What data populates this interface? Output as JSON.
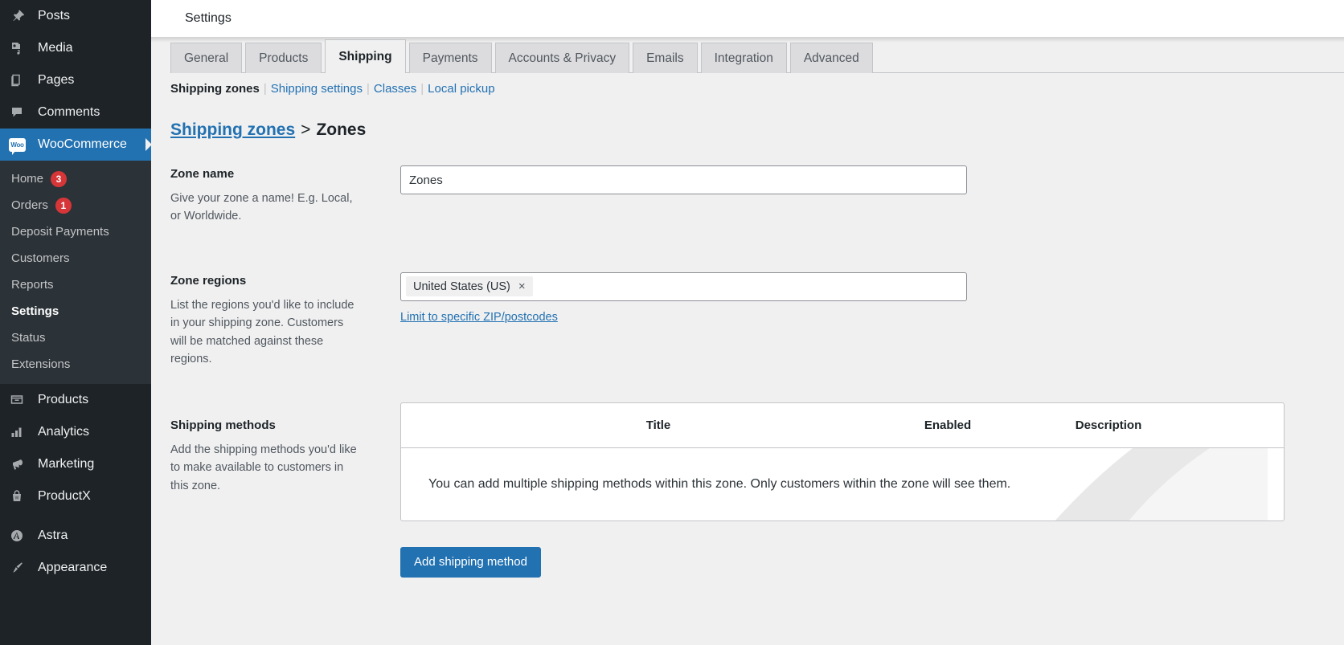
{
  "sidebar": {
    "items": [
      {
        "label": "Posts",
        "icon": "pin-icon",
        "current": false
      },
      {
        "label": "Media",
        "icon": "media-icon",
        "current": false
      },
      {
        "label": "Pages",
        "icon": "pages-icon",
        "current": false
      },
      {
        "label": "Comments",
        "icon": "comment-icon",
        "current": false
      },
      {
        "label": "WooCommerce",
        "icon": "woocommerce-icon",
        "current": true
      }
    ],
    "submenu": [
      {
        "label": "Home",
        "badge": "3",
        "current": false
      },
      {
        "label": "Orders",
        "badge": "1",
        "current": false
      },
      {
        "label": "Deposit Payments",
        "badge": "",
        "current": false
      },
      {
        "label": "Customers",
        "badge": "",
        "current": false
      },
      {
        "label": "Reports",
        "badge": "",
        "current": false
      },
      {
        "label": "Settings",
        "badge": "",
        "current": true
      },
      {
        "label": "Status",
        "badge": "",
        "current": false
      },
      {
        "label": "Extensions",
        "badge": "",
        "current": false
      }
    ],
    "items_lower": [
      {
        "label": "Products",
        "icon": "products-icon"
      },
      {
        "label": "Analytics",
        "icon": "analytics-icon"
      },
      {
        "label": "Marketing",
        "icon": "megaphone-icon"
      },
      {
        "label": "ProductX",
        "icon": "productx-icon"
      }
    ],
    "items_bottom": [
      {
        "label": "Astra",
        "icon": "astra-icon"
      },
      {
        "label": "Appearance",
        "icon": "brush-icon"
      }
    ],
    "woo_badge_text": "Woo"
  },
  "topbar": {
    "title": "Settings"
  },
  "tabs": [
    {
      "label": "General",
      "active": false
    },
    {
      "label": "Products",
      "active": false
    },
    {
      "label": "Shipping",
      "active": true
    },
    {
      "label": "Payments",
      "active": false
    },
    {
      "label": "Accounts & Privacy",
      "active": false
    },
    {
      "label": "Emails",
      "active": false
    },
    {
      "label": "Integration",
      "active": false
    },
    {
      "label": "Advanced",
      "active": false
    }
  ],
  "subnav": [
    {
      "label": "Shipping zones",
      "current": true
    },
    {
      "label": "Shipping settings",
      "current": false
    },
    {
      "label": "Classes",
      "current": false
    },
    {
      "label": "Local pickup",
      "current": false
    }
  ],
  "breadcrumb": {
    "parent": "Shipping zones",
    "separator": ">",
    "current": "Zones"
  },
  "zone_name": {
    "title": "Zone name",
    "description": "Give your zone a name! E.g. Local, or Worldwide.",
    "value": "Zones",
    "placeholder": "Zone name"
  },
  "zone_regions": {
    "title": "Zone regions",
    "description": "List the regions you'd like to include in your shipping zone. Customers will be matched against these regions.",
    "chips": [
      "United States (US)"
    ],
    "chip_remove_glyph": "×",
    "limit_link": "Limit to specific ZIP/postcodes"
  },
  "shipping_methods": {
    "title": "Shipping methods",
    "description": "Add the shipping methods you'd like to make available to customers in this zone.",
    "columns": [
      "",
      "Title",
      "Enabled",
      "Description"
    ],
    "empty_message": "You can add multiple shipping methods within this zone. Only customers within the zone will see them.",
    "add_button": "Add shipping method"
  },
  "colors": {
    "accent": "#2271b1",
    "sidebar_bg": "#1d2327",
    "submenu_bg": "#2c3338",
    "badge_red": "#d63638",
    "page_bg": "#f0f0f1"
  }
}
